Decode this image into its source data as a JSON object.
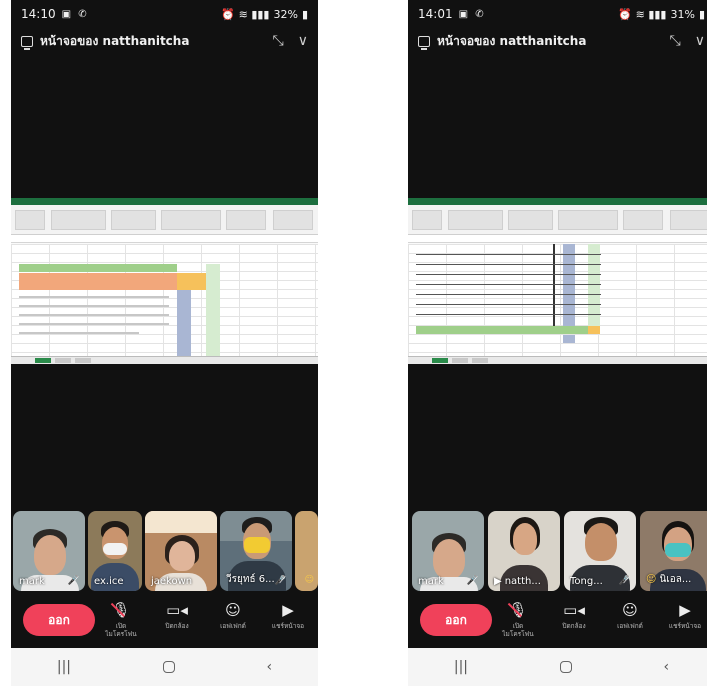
{
  "phones": [
    {
      "status": {
        "time": "14:10",
        "battery": "32%"
      },
      "title": "หน้าจอของ natthanitcha",
      "participants": [
        {
          "name": "mark"
        },
        {
          "name": "ex.ice"
        },
        {
          "name": "jaekown"
        },
        {
          "name": "วีรยุทธ์ 6..."
        }
      ]
    },
    {
      "status": {
        "time": "14:01",
        "battery": "31%"
      },
      "title": "หน้าจอของ natthanitcha",
      "participants": [
        {
          "name": "mark"
        },
        {
          "name": "natth..."
        },
        {
          "name": "Tong..."
        },
        {
          "name": "นิเอล..."
        }
      ]
    }
  ],
  "controls": {
    "leave": "ออก",
    "mic": "เปิด\nไมโครโฟน",
    "video": "ปิดกล้อง",
    "effects": "เอฟเฟกต์",
    "share": "แชร์หน้าจอ"
  },
  "colors": {
    "leave_button": "#f0415a",
    "excel_green": "#1d6f3f"
  }
}
